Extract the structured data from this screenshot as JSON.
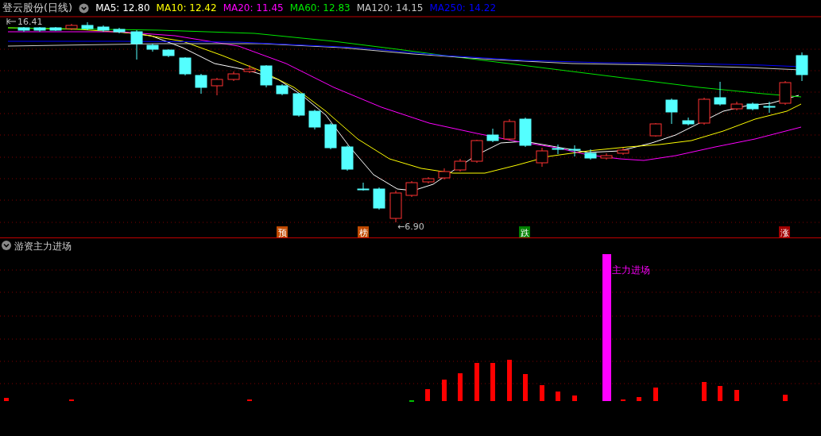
{
  "header": {
    "title": "登云股份(日线)",
    "indicators": [
      {
        "label": "MA5: 12.80",
        "color": "#ffffff"
      },
      {
        "label": "MA10: 12.42",
        "color": "#ffff00"
      },
      {
        "label": "MA20: 11.45",
        "color": "#ff00ff"
      },
      {
        "label": "MA60: 12.83",
        "color": "#00e600"
      },
      {
        "label": "MA120: 14.15",
        "color": "#c8c8c8"
      },
      {
        "label": "MA250: 14.22",
        "color": "#0000ff"
      }
    ]
  },
  "price_chart": {
    "high_label": "16.41",
    "low_label": "←6.90",
    "signals": [
      {
        "text": "预",
        "color": "#c04a00"
      },
      {
        "text": "榜",
        "color": "#c04a00"
      },
      {
        "text": "跌",
        "color": "#008000"
      },
      {
        "text": "涨",
        "color": "#a00000"
      }
    ]
  },
  "indicator_panel": {
    "title": "游资主力进场",
    "signal_label": "主力进场"
  }
}
